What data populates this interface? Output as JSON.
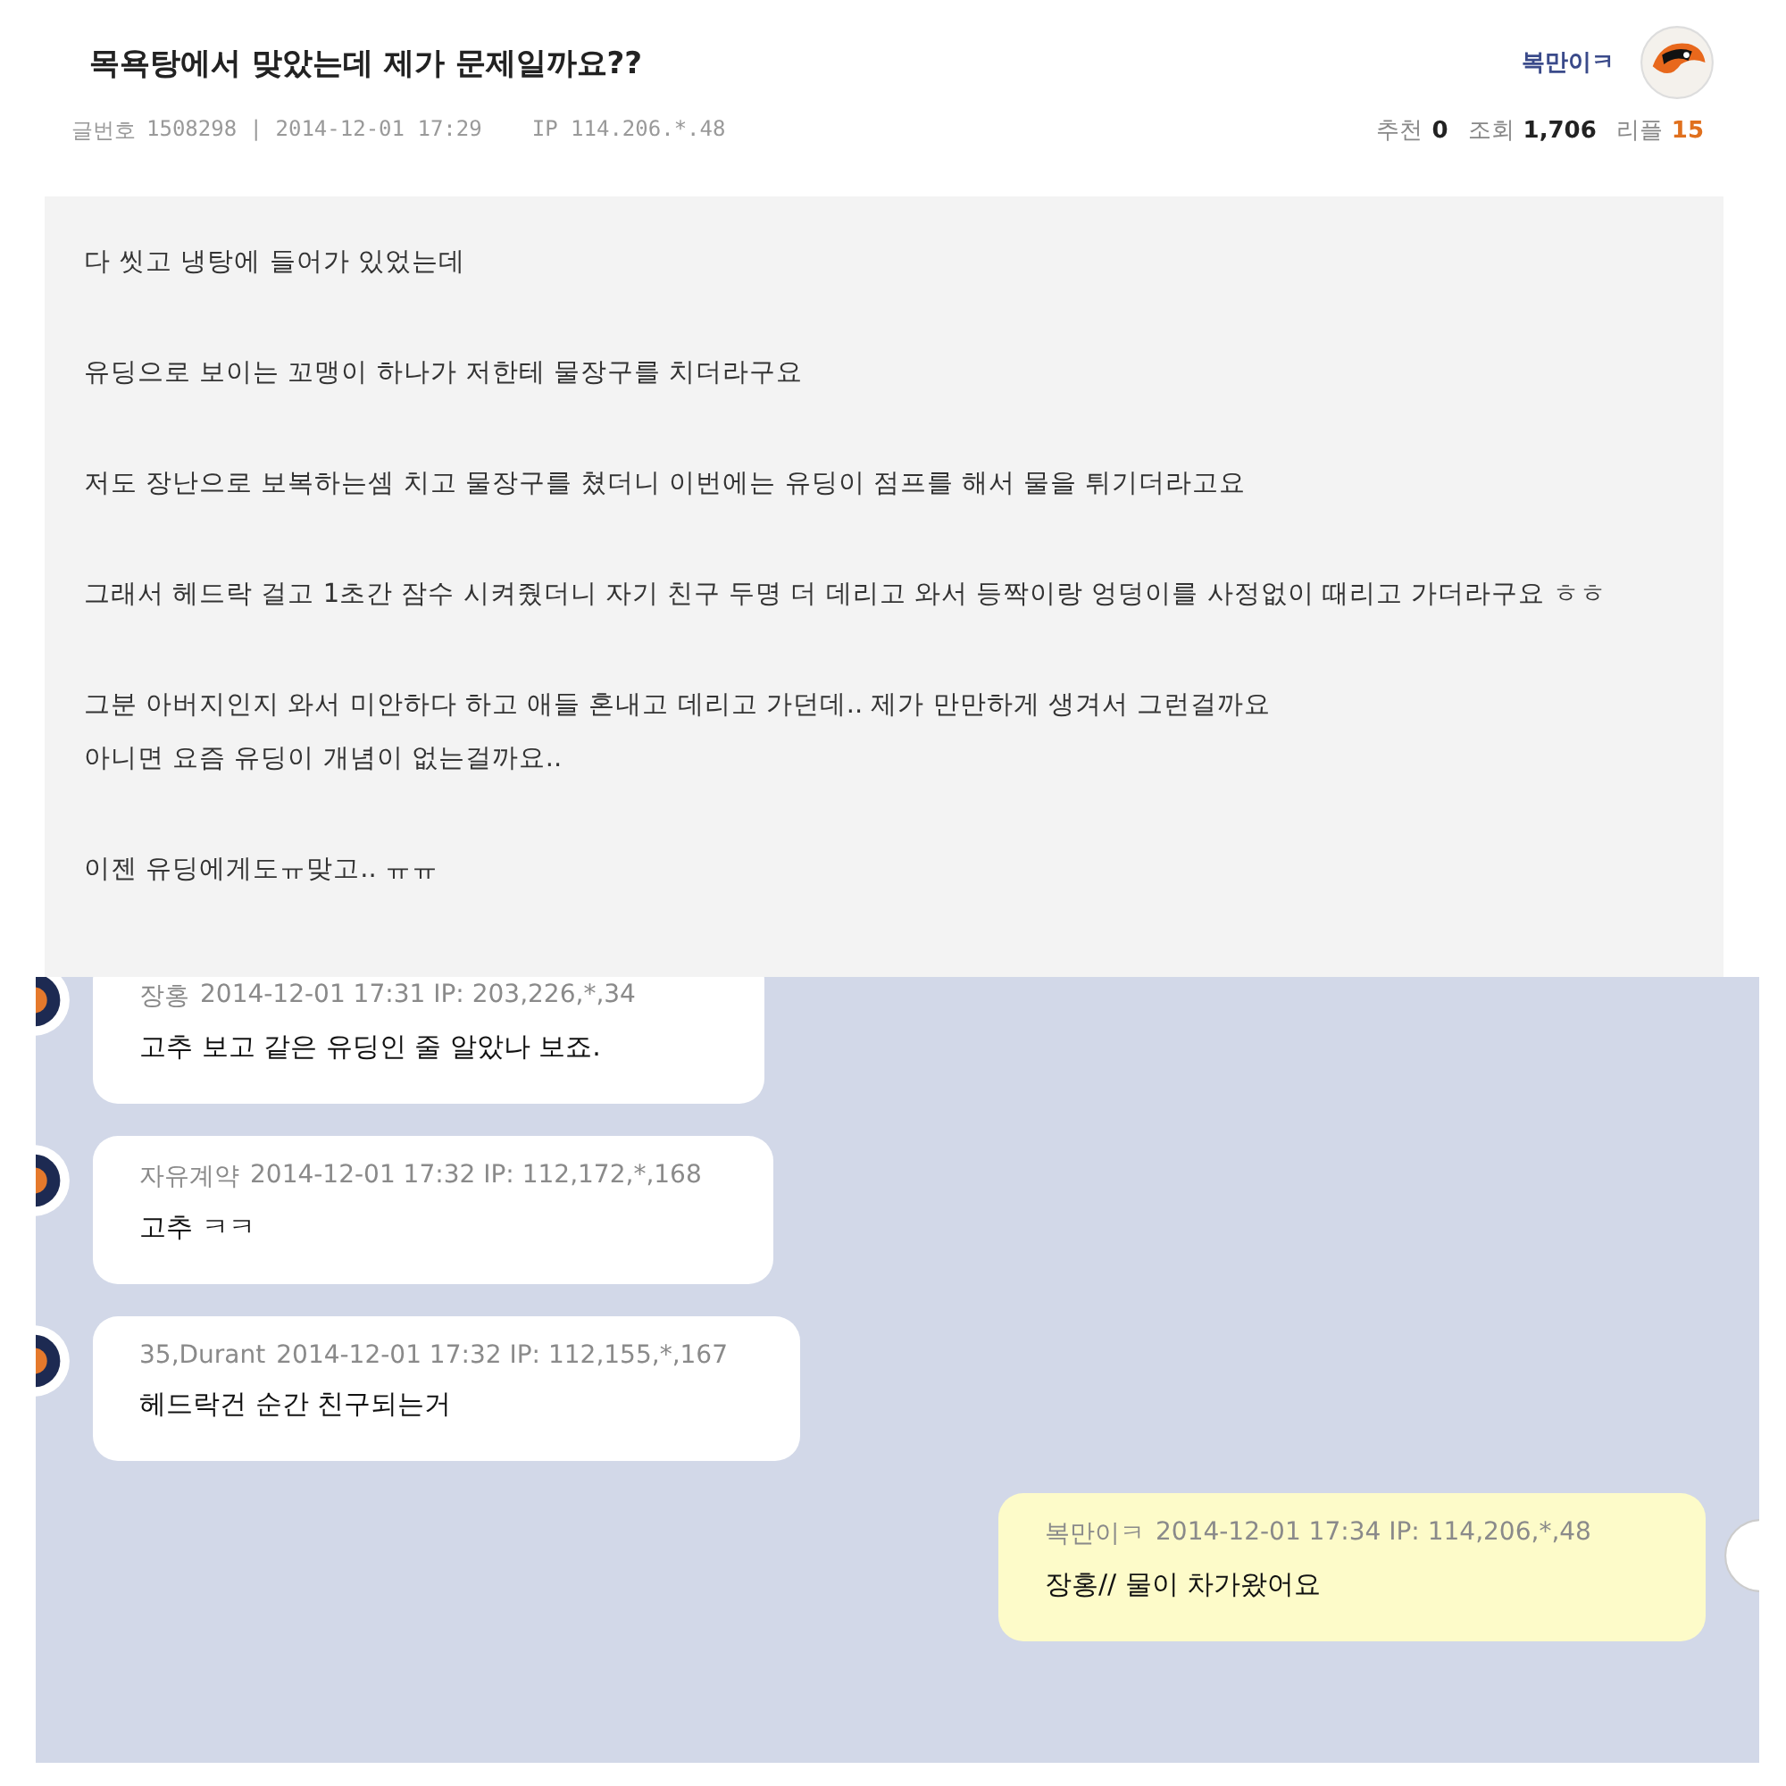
{
  "post": {
    "title": "목욕탕에서 맞았는데 제가 문제일까요??",
    "author": "복만이ㅋ",
    "meta": {
      "number_label": "글번호",
      "number": "1508298 | 2014-12-01 17:29",
      "ip": "IP 114.206.*.48"
    },
    "stats": [
      {
        "label": "추천",
        "value": "0",
        "color": "#222222"
      },
      {
        "label": "조회",
        "value": "1,706",
        "color": "#222222"
      },
      {
        "label": "리플",
        "value": "15",
        "color": "#e0701e"
      }
    ],
    "paragraphs": [
      [
        "다 씻고 냉탕에 들어가 있었는데"
      ],
      [
        "유딩으로 보이는 꼬맹이 하나가 저한테 물장구를 치더라구요"
      ],
      [
        "저도 장난으로 보복하는셈 치고 물장구를 쳤더니 이번에는 유딩이 점프를 해서 물을 튀기더라고요"
      ],
      [
        "그래서 헤드락 걸고 1초간 잠수 시켜줬더니 자기 친구 두명 더 데리고 와서 등짝이랑 엉덩이를 사정없이 때리고 가더라구요 ㅎㅎ"
      ],
      [
        "그분 아버지인지 와서 미안하다 하고 애들 혼내고 데리고 가던데.. 제가 만만하게 생겨서 그런걸까요",
        "아니면 요즘 유딩이 개념이 없는걸까요.."
      ],
      [
        "이젠 유딩에게도ㅠ맞고.. ㅠㅠ"
      ]
    ]
  },
  "comments": [
    {
      "author": "장홍",
      "meta": "2014-12-01 17:31 IP: 203,226,*,34",
      "text": "고추 보고 같은 유딩인 줄 알았나 보죠.",
      "mine": false
    },
    {
      "author": "자유계약",
      "meta": "2014-12-01 17:32 IP: 112,172,*,168",
      "text": "고추 ㅋㅋ",
      "mine": false
    },
    {
      "author": "35,Durant",
      "meta": "2014-12-01 17:32 IP: 112,155,*,167",
      "text": "헤드락건 순간 친구되는거",
      "mine": false
    },
    {
      "author": "복만이ㅋ",
      "meta": "2014-12-01 17:34 IP: 114,206,*,48",
      "text": "장홍// 물이 차가왔어요",
      "mine": true
    }
  ]
}
